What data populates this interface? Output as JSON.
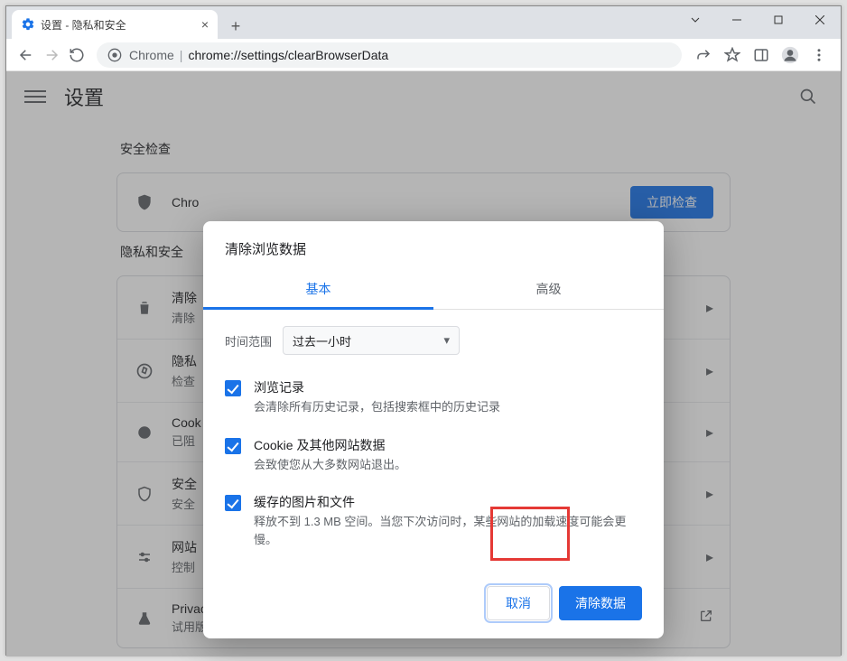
{
  "window": {
    "tab_title": "设置 - 隐私和安全"
  },
  "omnibox": {
    "chrome_label": "Chrome",
    "url_display": "chrome://settings/clearBrowserData"
  },
  "page": {
    "app_title": "设置"
  },
  "section1": {
    "label": "安全检查",
    "row_title_partial": "Chro",
    "cta": "立即检查"
  },
  "section2": {
    "label": "隐私和安全",
    "rows": [
      {
        "title": "清除",
        "sub": "清除"
      },
      {
        "title": "隐私",
        "sub": "检查"
      },
      {
        "title": "Cook",
        "sub": "已阻"
      },
      {
        "title": "安全",
        "sub": "安全"
      },
      {
        "title": "网站",
        "sub": "控制"
      },
      {
        "title": "Privacy Sandbox",
        "sub": "试用版功能已关闭"
      }
    ]
  },
  "dialog": {
    "title": "清除浏览数据",
    "tab_basic": "基本",
    "tab_advanced": "高级",
    "time_label": "时间范围",
    "time_value": "过去一小时",
    "items": [
      {
        "title": "浏览记录",
        "sub": "会清除所有历史记录，包括搜索框中的历史记录"
      },
      {
        "title": "Cookie 及其他网站数据",
        "sub": "会致使您从大多数网站退出。"
      },
      {
        "title": "缓存的图片和文件",
        "sub": "释放不到 1.3 MB 空间。当您下次访问时，某些网站的加载速度可能会更慢。"
      }
    ],
    "cancel": "取消",
    "confirm": "清除数据"
  }
}
